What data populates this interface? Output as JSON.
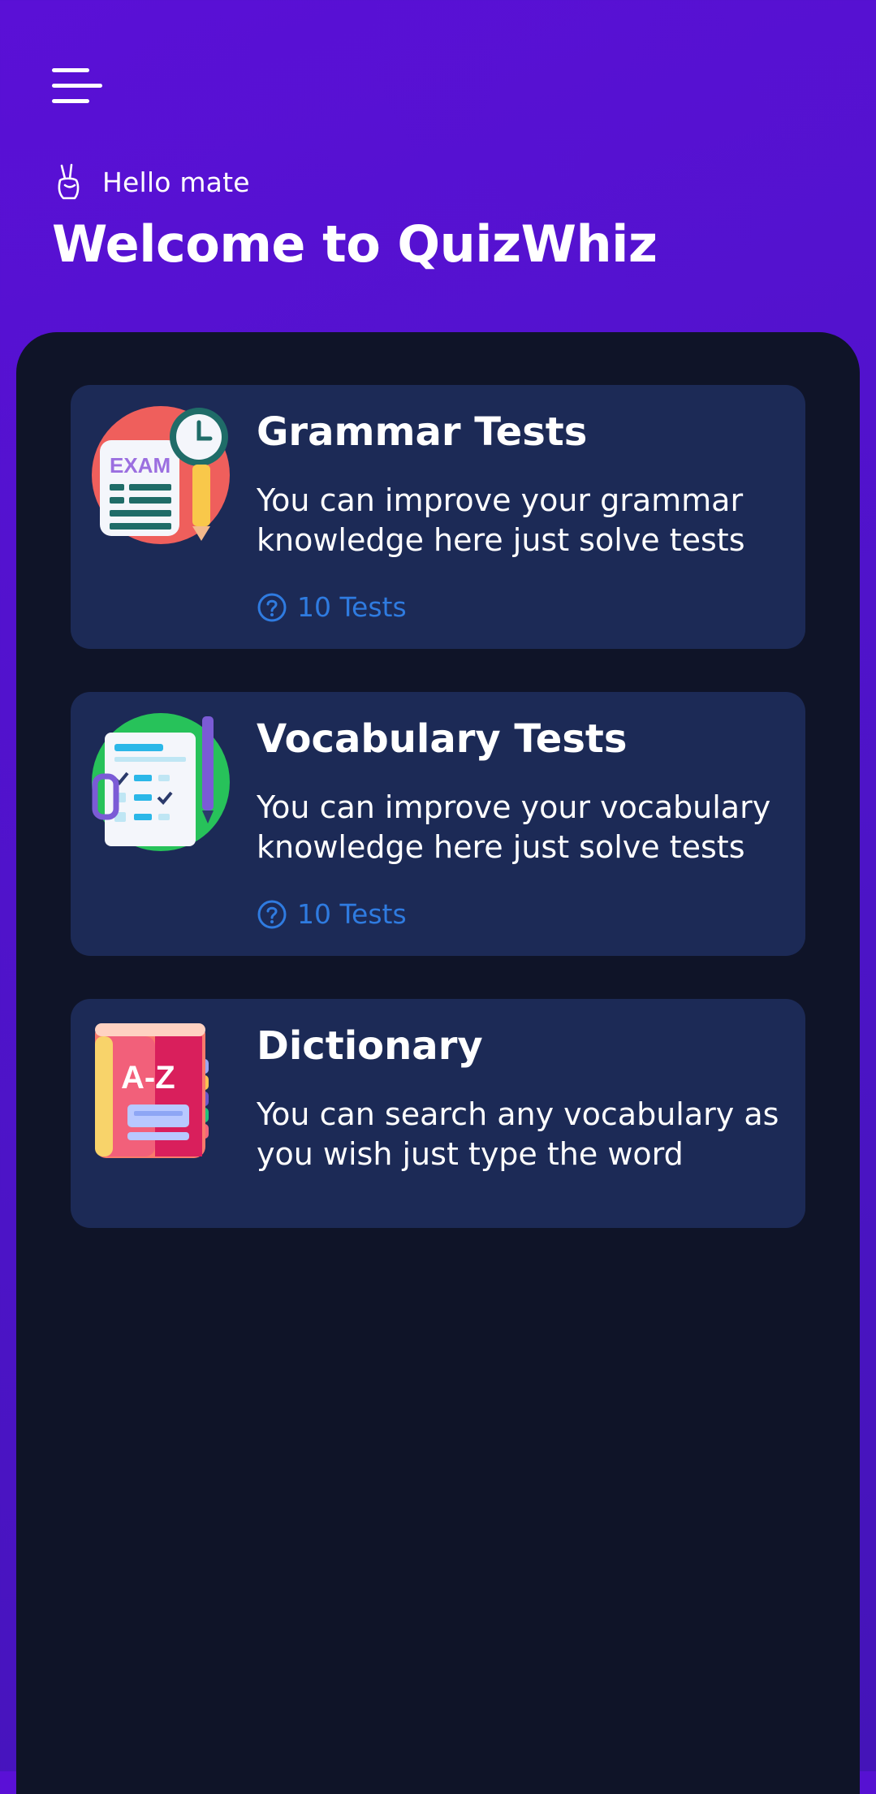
{
  "header": {
    "greeting": "Hello mate",
    "title": "Welcome to QuizWhiz"
  },
  "cards": [
    {
      "title": "Grammar Tests",
      "description": "You can improve your grammar knowledge here just solve tests",
      "count": "10 Tests",
      "icon": "exam-clock-icon"
    },
    {
      "title": "Vocabulary Tests",
      "description": "You can improve your vocabulary knowledge here just solve tests",
      "count": "10 Tests",
      "icon": "checklist-icon"
    },
    {
      "title": "Dictionary",
      "description": "You can search any vocabulary as you wish just type the word",
      "icon": "a-z-book-icon"
    }
  ],
  "icon_labels": {
    "exam": "EXAM",
    "dictionary": "A-Z"
  },
  "colors": {
    "background": "#5a10d6",
    "panel": "#0f1428",
    "card": "#1c2a56",
    "count_accent": "#2f7be0"
  }
}
